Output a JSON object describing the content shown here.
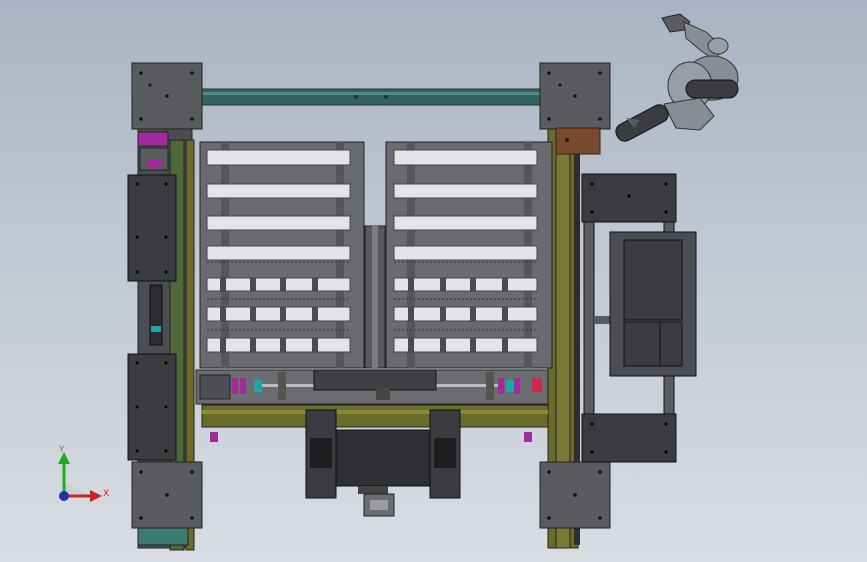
{
  "colors": {
    "background_top": "#aab3c3",
    "background_bottom": "#d9dde3",
    "plate_dark": "#3a3c40",
    "plate_mid": "#5a5c60",
    "rail_olive": "#6b6b2a",
    "rail_green": "#4f6a3a",
    "rod_teal": "#35625e",
    "accent_magenta": "#a22a9a",
    "accent_cyan": "#1ea7a7",
    "bracket_brown": "#7a4a2e",
    "robot_gray": "#8a8e94",
    "axis_x": "#cc2222",
    "axis_y": "#22aa22",
    "axis_z": "#2233aa"
  },
  "triad": {
    "x_label": "X",
    "y_label": "Y"
  }
}
